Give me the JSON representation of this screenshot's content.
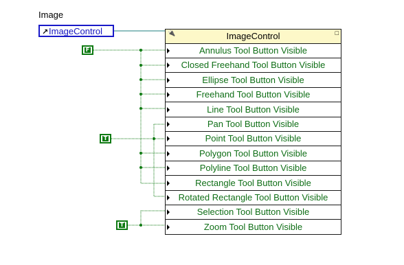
{
  "label": "Image",
  "control": {
    "name": "ImageControl"
  },
  "node": {
    "title": "ImageControl",
    "properties": [
      "Annulus Tool Button Visible",
      "Closed Freehand Tool Button Visible",
      "Ellipse Tool Button Visible",
      "Freehand Tool Button Visible",
      "Line Tool Button Visible",
      "Pan Tool Button Visible",
      "Point Tool Button Visible",
      "Polygon Tool Button Visible",
      "Polyline Tool Button Visible",
      "Rectangle Tool Button Visible",
      "Rotated Rectangle Tool Button Visible",
      "Selection Tool Button Visible",
      "Zoom Tool Button Visible"
    ]
  },
  "constants": [
    {
      "value": "F"
    },
    {
      "value": "T"
    },
    {
      "value": "T"
    }
  ],
  "colors": {
    "wire": "#0e7a12",
    "reference_wire": "#1e7f7f",
    "property_text": "#0f6e16",
    "header_bg": "#fdf8c8",
    "control_border": "#1818c8"
  }
}
